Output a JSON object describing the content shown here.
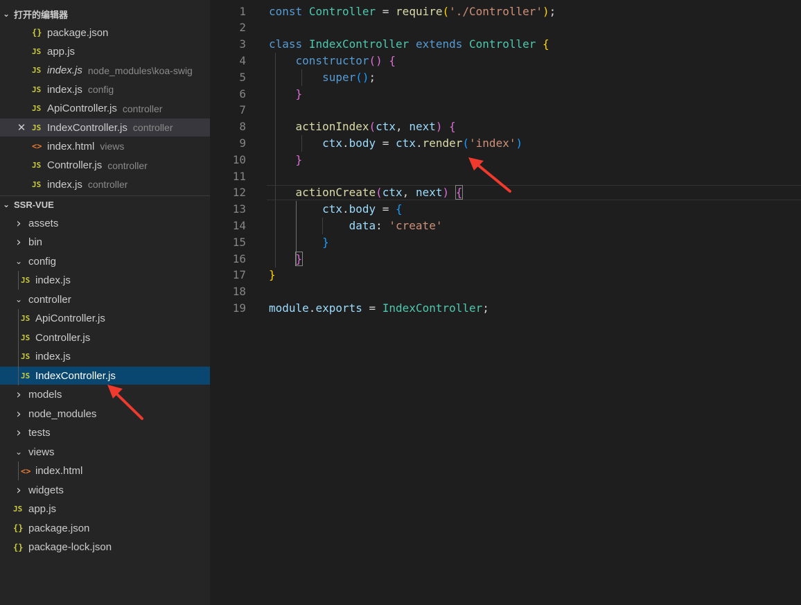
{
  "explorer": {
    "open_editors_title": "打开的编辑器",
    "open_editors": [
      {
        "icon": "json",
        "name": "package.json",
        "desc": ""
      },
      {
        "icon": "js",
        "name": "app.js",
        "desc": ""
      },
      {
        "icon": "js",
        "name": "index.js",
        "desc": "node_modules\\koa-swig",
        "italic": true
      },
      {
        "icon": "js",
        "name": "index.js",
        "desc": "config"
      },
      {
        "icon": "js",
        "name": "ApiController.js",
        "desc": "controller"
      },
      {
        "icon": "js",
        "name": "IndexController.js",
        "desc": "controller",
        "active": true
      },
      {
        "icon": "html",
        "name": "index.html",
        "desc": "views"
      },
      {
        "icon": "js",
        "name": "Controller.js",
        "desc": "controller"
      },
      {
        "icon": "js",
        "name": "index.js",
        "desc": "controller"
      }
    ],
    "project_title": "SSR-VUE",
    "tree": [
      {
        "type": "folder",
        "name": "assets",
        "open": false
      },
      {
        "type": "folder",
        "name": "bin",
        "open": false
      },
      {
        "type": "folder",
        "name": "config",
        "open": true
      },
      {
        "type": "file",
        "icon": "js",
        "name": "index.js",
        "depth": 1
      },
      {
        "type": "folder",
        "name": "controller",
        "open": true
      },
      {
        "type": "file",
        "icon": "js",
        "name": "ApiController.js",
        "depth": 1
      },
      {
        "type": "file",
        "icon": "js",
        "name": "Controller.js",
        "depth": 1
      },
      {
        "type": "file",
        "icon": "js",
        "name": "index.js",
        "depth": 1
      },
      {
        "type": "file",
        "icon": "js",
        "name": "IndexController.js",
        "depth": 1,
        "selected": true
      },
      {
        "type": "folder",
        "name": "models",
        "open": false
      },
      {
        "type": "folder",
        "name": "node_modules",
        "open": false
      },
      {
        "type": "folder",
        "name": "tests",
        "open": false
      },
      {
        "type": "folder",
        "name": "views",
        "open": true
      },
      {
        "type": "file",
        "icon": "html",
        "name": "index.html",
        "depth": 1
      },
      {
        "type": "folder",
        "name": "widgets",
        "open": false
      },
      {
        "type": "file",
        "icon": "js",
        "name": "app.js",
        "depth": 0
      },
      {
        "type": "file",
        "icon": "json",
        "name": "package.json",
        "depth": 0
      },
      {
        "type": "file",
        "icon": "json",
        "name": "package-lock.json",
        "depth": 0
      }
    ],
    "icon_glyphs": {
      "js": "JS",
      "json": "{}",
      "html": "<>"
    }
  },
  "editor": {
    "file": "IndexController.js",
    "lines": [
      {
        "n": "1",
        "tokens": [
          [
            "kw",
            "const"
          ],
          [
            "code",
            " "
          ],
          [
            "cls",
            "Controller"
          ],
          [
            "code",
            " = "
          ],
          [
            "fn",
            "require"
          ],
          [
            "b1",
            "("
          ],
          [
            "str",
            "'./Controller'"
          ],
          [
            "b1",
            ")"
          ],
          [
            "code",
            ";"
          ]
        ]
      },
      {
        "n": "2",
        "tokens": []
      },
      {
        "n": "3",
        "tokens": [
          [
            "kw",
            "class"
          ],
          [
            "code",
            " "
          ],
          [
            "cls",
            "IndexController"
          ],
          [
            "code",
            " "
          ],
          [
            "kw",
            "extends"
          ],
          [
            "code",
            " "
          ],
          [
            "cls",
            "Controller"
          ],
          [
            "code",
            " "
          ],
          [
            "b1",
            "{"
          ]
        ]
      },
      {
        "n": "4",
        "tokens": [
          [
            "code",
            "    "
          ],
          [
            "kw",
            "constructor"
          ],
          [
            "b2",
            "()"
          ],
          [
            "code",
            " "
          ],
          [
            "b2",
            "{"
          ]
        ]
      },
      {
        "n": "5",
        "tokens": [
          [
            "code",
            "        "
          ],
          [
            "kw",
            "super"
          ],
          [
            "b3",
            "()"
          ],
          [
            "code",
            ";"
          ]
        ]
      },
      {
        "n": "6",
        "tokens": [
          [
            "code",
            "    "
          ],
          [
            "b2",
            "}"
          ]
        ]
      },
      {
        "n": "7",
        "tokens": []
      },
      {
        "n": "8",
        "tokens": [
          [
            "code",
            "    "
          ],
          [
            "fn",
            "actionIndex"
          ],
          [
            "b2",
            "("
          ],
          [
            "var",
            "ctx"
          ],
          [
            "code",
            ", "
          ],
          [
            "var",
            "next"
          ],
          [
            "b2",
            ")"
          ],
          [
            "code",
            " "
          ],
          [
            "b2",
            "{"
          ]
        ]
      },
      {
        "n": "9",
        "tokens": [
          [
            "code",
            "        "
          ],
          [
            "var",
            "ctx"
          ],
          [
            "code",
            "."
          ],
          [
            "prop",
            "body"
          ],
          [
            "code",
            " = "
          ],
          [
            "var",
            "ctx"
          ],
          [
            "code",
            "."
          ],
          [
            "fn",
            "render"
          ],
          [
            "b3",
            "("
          ],
          [
            "str",
            "'index'"
          ],
          [
            "b3",
            ")"
          ]
        ]
      },
      {
        "n": "10",
        "tokens": [
          [
            "code",
            "    "
          ],
          [
            "b2",
            "}"
          ]
        ]
      },
      {
        "n": "11",
        "tokens": []
      },
      {
        "n": "12",
        "tokens": [
          [
            "code",
            "    "
          ],
          [
            "fn",
            "actionCreate"
          ],
          [
            "b2",
            "("
          ],
          [
            "var",
            "ctx"
          ],
          [
            "code",
            ", "
          ],
          [
            "var",
            "next"
          ],
          [
            "b2",
            ")"
          ],
          [
            "code",
            " "
          ],
          [
            "b2 bm",
            "{"
          ]
        ]
      },
      {
        "n": "13",
        "tokens": [
          [
            "code",
            "        "
          ],
          [
            "var",
            "ctx"
          ],
          [
            "code",
            "."
          ],
          [
            "prop",
            "body"
          ],
          [
            "code",
            " = "
          ],
          [
            "b3",
            "{"
          ]
        ]
      },
      {
        "n": "14",
        "tokens": [
          [
            "code",
            "            "
          ],
          [
            "prop",
            "data"
          ],
          [
            "code",
            ": "
          ],
          [
            "str",
            "'create'"
          ]
        ]
      },
      {
        "n": "15",
        "tokens": [
          [
            "code",
            "        "
          ],
          [
            "b3",
            "}"
          ]
        ]
      },
      {
        "n": "16",
        "tokens": [
          [
            "code",
            "    "
          ],
          [
            "b2 bm",
            "}"
          ]
        ]
      },
      {
        "n": "17",
        "tokens": [
          [
            "b1",
            "}"
          ]
        ]
      },
      {
        "n": "18",
        "tokens": []
      },
      {
        "n": "19",
        "tokens": [
          [
            "var",
            "module"
          ],
          [
            "code",
            "."
          ],
          [
            "var",
            "exports"
          ],
          [
            "code",
            " = "
          ],
          [
            "cls",
            "IndexController"
          ],
          [
            "code",
            ";"
          ]
        ]
      }
    ]
  },
  "colors": {
    "arrow": "#f03a2e",
    "selected_bg": "#094771",
    "sidebar_bg": "#252526",
    "editor_bg": "#1e1e1e"
  }
}
